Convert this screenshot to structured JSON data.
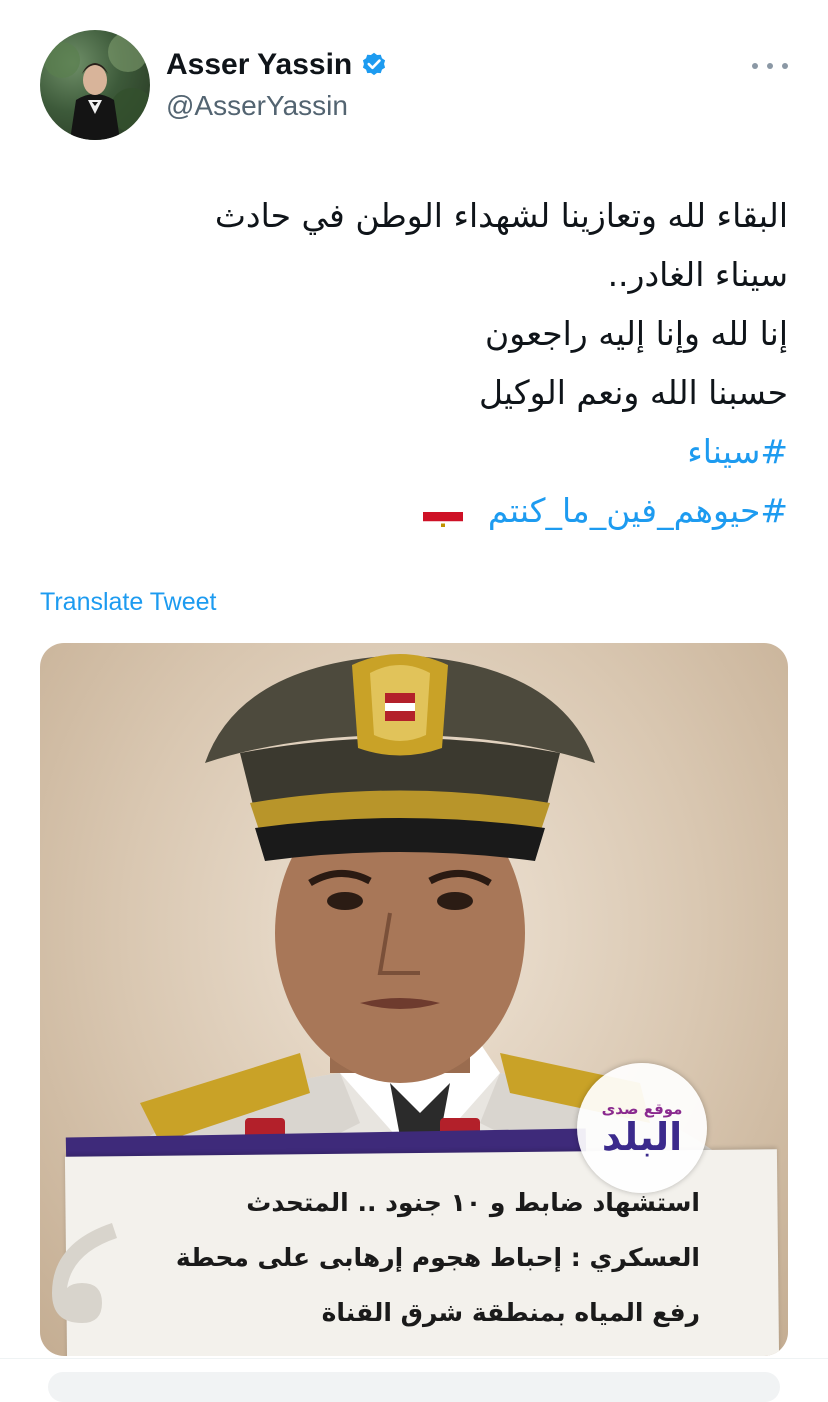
{
  "author": {
    "display_name": "Asser Yassin",
    "handle": "@AsserYassin",
    "verified": true,
    "avatar_icon": "profile-photo"
  },
  "more_icon": "ellipsis-icon",
  "tweet": {
    "lines": [
      "البقاء لله وتعازينا لشهداء الوطن في حادث",
      "سيناء الغادر..",
      "إنا لله وإنا إليه راجعون",
      "حسبنا الله ونعم الوكيل"
    ],
    "hashtags": [
      "#سيناء",
      "#حيوهم_فين_ما_كنتم"
    ],
    "flag_emoji": "egypt-flag"
  },
  "translate_label": "Translate Tweet",
  "media": {
    "logo_small": "موقع صدى",
    "logo_big": "البلد",
    "caption_lines": [
      "استشهاد ضابط و ١٠ جنود .. المتحدث",
      "العسكري : إحباط هجوم إرهابى على محطة",
      "رفع المياه بمنطقة شرق القناة"
    ]
  },
  "colors": {
    "link": "#1d9bf0",
    "text": "#0f1419",
    "secondary": "#536471",
    "verified": "#1d9bf0"
  }
}
